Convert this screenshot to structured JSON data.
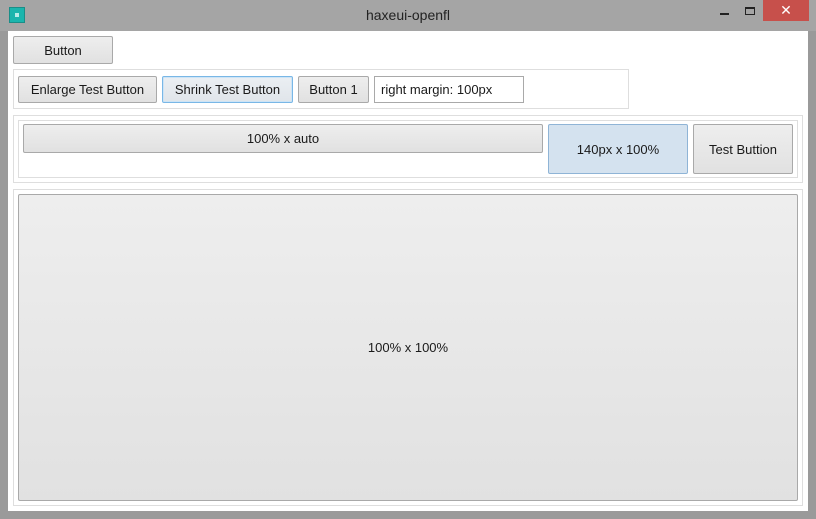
{
  "window": {
    "title": "haxeui-openfl",
    "controls": {
      "close_label": "✕"
    }
  },
  "row1": {
    "button_label": "Button"
  },
  "row2": {
    "enlarge_label": "Enlarge Test Button",
    "shrink_label": "Shrink Test Button",
    "button1_label": "Button 1",
    "text_value": "right margin: 100px"
  },
  "row3": {
    "auto_label": "100% x auto",
    "fixed_label": "140px x 100%",
    "test_label": "Test Buttion"
  },
  "row4": {
    "full_label": "100% x 100%"
  },
  "colors": {
    "close_red": "#c7504b",
    "icon_teal": "#1bb5ad",
    "selected_blue": "#d4e2ef"
  }
}
